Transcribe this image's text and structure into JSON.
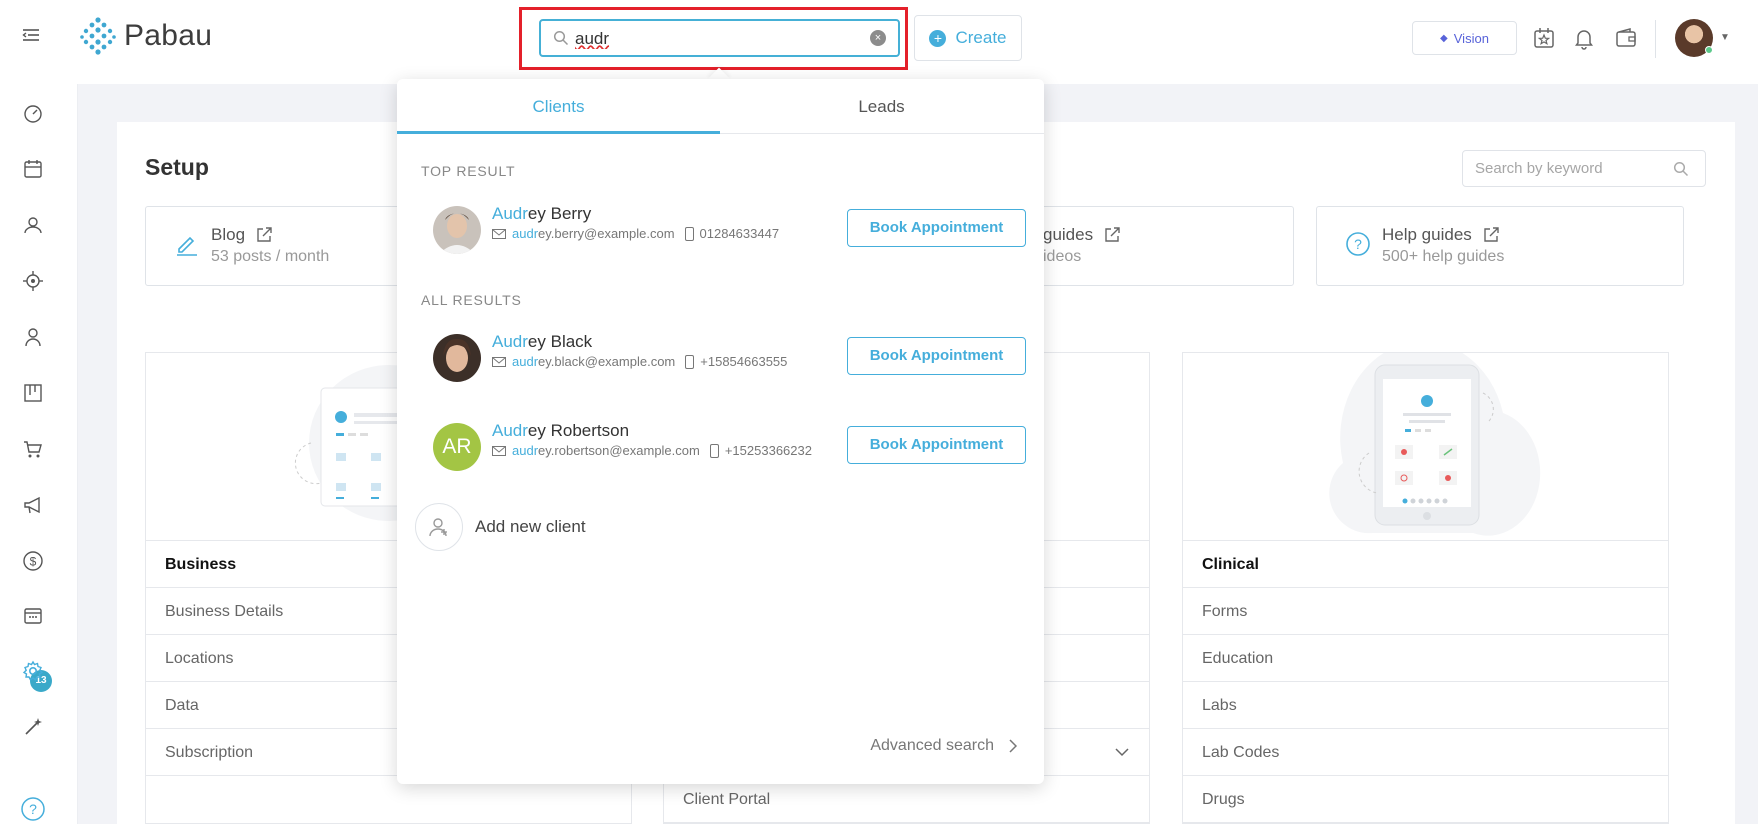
{
  "header": {
    "brand": "Pabau",
    "search": {
      "value": "audr"
    },
    "create_label": "Create",
    "vision_label": "Vision"
  },
  "sidebar": {
    "icons": [
      "dashboard-icon",
      "calendar-icon",
      "clients-icon",
      "leads-icon",
      "contacts-icon",
      "board-icon",
      "cart-icon",
      "marketing-icon",
      "finance-icon",
      "staff-calendar-icon",
      "settings-icon",
      "magic-icon",
      "help-icon"
    ],
    "badge": "13",
    "active": "settings-icon"
  },
  "setup": {
    "title": "Setup",
    "keyword_placeholder": "Search by keyword",
    "cards": [
      {
        "title": "Blog",
        "subtitle": "53 posts / month"
      },
      {
        "title": "guides",
        "subtitle": "ideos"
      },
      {
        "title": "Help guides",
        "subtitle": "500+ help guides"
      }
    ],
    "sections": [
      {
        "heading": "Business",
        "items": [
          "Business Details",
          "Locations",
          "Data",
          "Subscription"
        ]
      },
      {
        "heading": "",
        "items": [
          "",
          "",
          "",
          "",
          "Client Portal"
        ]
      },
      {
        "heading": "Clinical",
        "items": [
          "Forms",
          "Education",
          "Labs",
          "Lab Codes",
          "Drugs"
        ]
      }
    ]
  },
  "dropdown": {
    "tabs": [
      "Clients",
      "Leads"
    ],
    "active_tab": "Clients",
    "top_result_label": "TOP RESULT",
    "all_results_label": "ALL RESULTS",
    "query_match": "Aud",
    "results": [
      {
        "name_match": "Audr",
        "name_rest": "ey Berry",
        "email_match": "audr",
        "email_rest": "ey.berry@example.com",
        "phone": "01284633447",
        "avatar": "photo",
        "button": "Book Appointment"
      },
      {
        "name_match": "Audr",
        "name_rest": "ey Black",
        "email_match": "audr",
        "email_rest": "ey.black@example.com",
        "phone": "+15854663555",
        "avatar": "photo",
        "button": "Book Appointment"
      },
      {
        "name_match": "Audr",
        "name_rest": "ey Robertson",
        "email_match": "audr",
        "email_rest": "ey.robertson@example.com",
        "phone": "+15253366232",
        "avatar": "AR",
        "button": "Book Appointment"
      }
    ],
    "add_new_client": "Add new client",
    "advanced_search": "Advanced search"
  },
  "colors": {
    "accent": "#45aedb",
    "highlight_box": "#e4202a",
    "badge": "#3aa9c9",
    "avatar_initials": "#a3c544"
  }
}
